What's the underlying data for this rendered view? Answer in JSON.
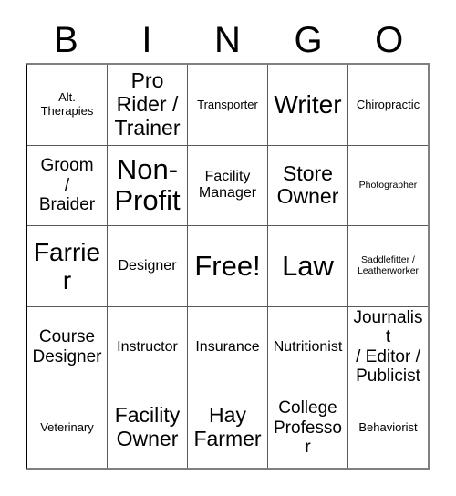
{
  "card": {
    "title": "BINGO",
    "header_letters": [
      "B",
      "I",
      "N",
      "G",
      "O"
    ],
    "free_space_label": "Free!",
    "colors": {
      "background": "#ffffff",
      "text": "#000000",
      "grid_line": "#595959",
      "outer_border": "#808080"
    },
    "rows": [
      [
        {
          "label": "Alt.\nTherapies",
          "size": "sm"
        },
        {
          "label": "Pro\nRider /\nTrainer",
          "size": "xl"
        },
        {
          "label": "Transporter",
          "size": "sm"
        },
        {
          "label": "Writer",
          "size": "xxl"
        },
        {
          "label": "Chiropractic",
          "size": "sm"
        }
      ],
      [
        {
          "label": "Groom\n/\nBraider",
          "size": "lg"
        },
        {
          "label": "Non-\nProfit",
          "size": "huge"
        },
        {
          "label": "Facility\nManager",
          "size": "md"
        },
        {
          "label": "Store\nOwner",
          "size": "xl"
        },
        {
          "label": "Photographer",
          "size": "xs"
        }
      ],
      [
        {
          "label": "Farrier",
          "size": "xxl"
        },
        {
          "label": "Designer",
          "size": "md"
        },
        {
          "label": "Free!",
          "size": "huge"
        },
        {
          "label": "Law",
          "size": "huge"
        },
        {
          "label": "Saddlefitter /\nLeatherworker",
          "size": "xs"
        }
      ],
      [
        {
          "label": "Course\nDesigner",
          "size": "lg"
        },
        {
          "label": "Instructor",
          "size": "md"
        },
        {
          "label": "Insurance",
          "size": "md"
        },
        {
          "label": "Nutritionist",
          "size": "md"
        },
        {
          "label": "Journalist\n/ Editor /\nPublicist",
          "size": "lg"
        }
      ],
      [
        {
          "label": "Veterinary",
          "size": "sm"
        },
        {
          "label": "Facility\nOwner",
          "size": "xl"
        },
        {
          "label": "Hay\nFarmer",
          "size": "xl"
        },
        {
          "label": "College\nProfessor",
          "size": "lg"
        },
        {
          "label": "Behaviorist",
          "size": "sm"
        }
      ]
    ]
  }
}
